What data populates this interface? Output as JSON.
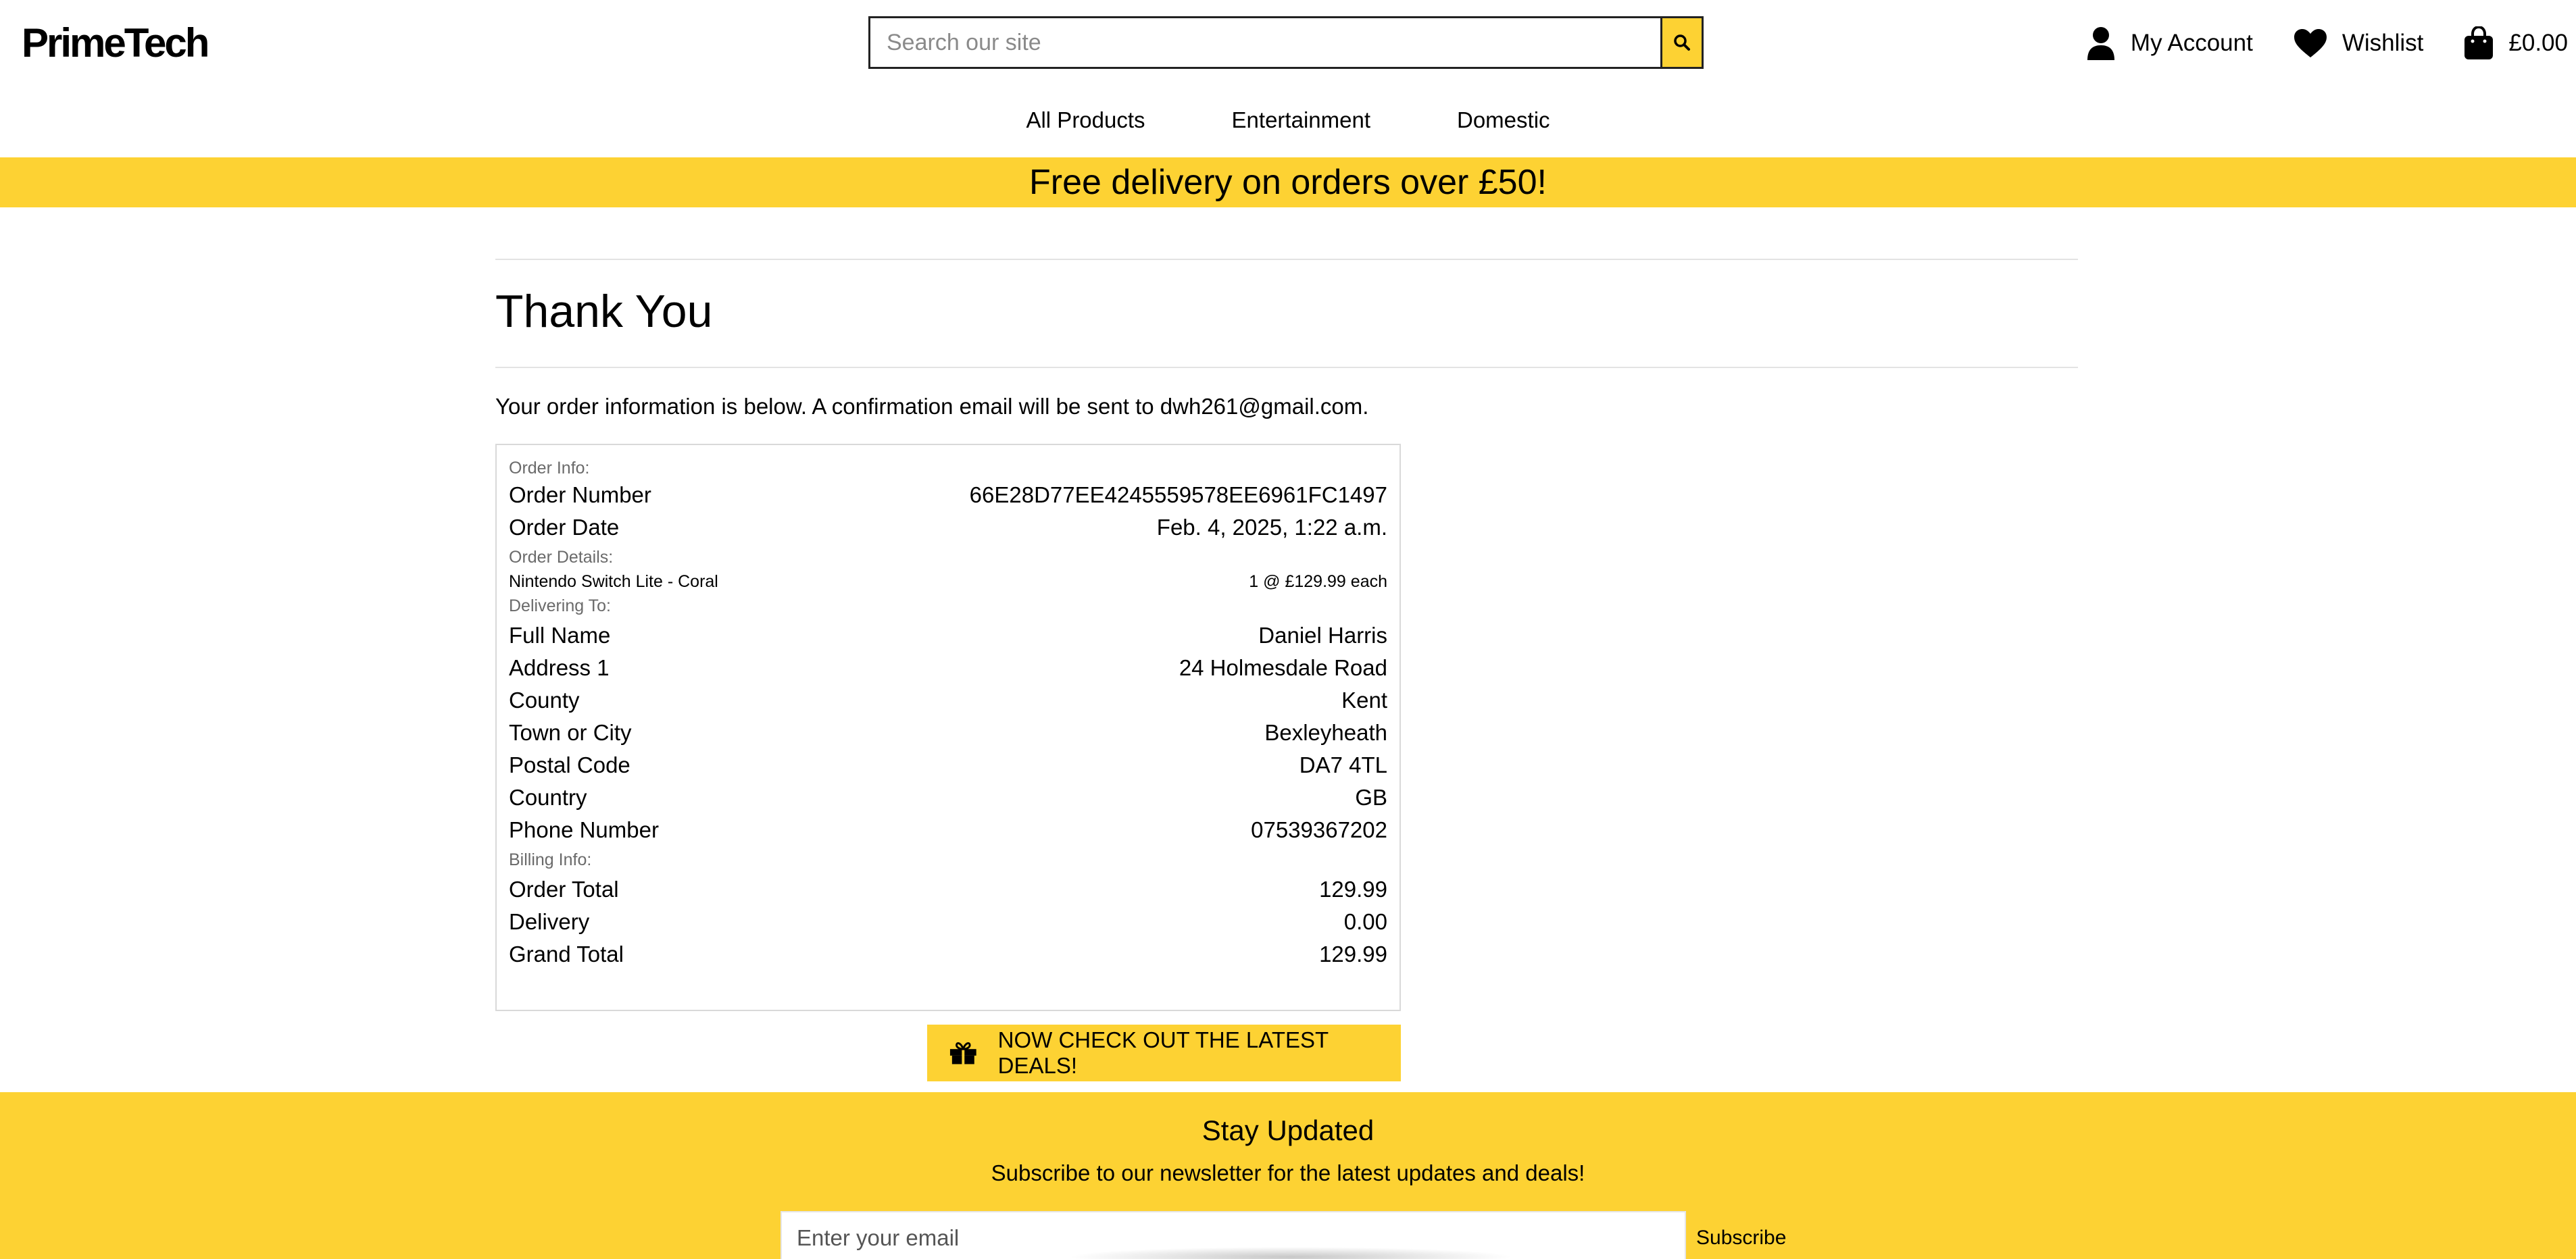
{
  "header": {
    "logo": "PrimeTech",
    "search": {
      "placeholder": "Search our site",
      "value": ""
    },
    "account_label": "My Account",
    "wishlist_label": "Wishlist",
    "bag_total": "£0.00"
  },
  "menu": {
    "items": [
      {
        "label": "All Products"
      },
      {
        "label": "Entertainment"
      },
      {
        "label": "Domestic"
      }
    ]
  },
  "banner": {
    "text": "Free delivery on orders over £50!"
  },
  "page": {
    "title": "Thank You",
    "intro": "Your order information is below. A confirmation email will be sent to dwh261@gmail.com."
  },
  "order": {
    "order_info_label": "Order Info:",
    "order_number_label": "Order Number",
    "order_number": "66E28D77EE4245559578EE6961FC1497",
    "order_date_label": "Order Date",
    "order_date": "Feb. 4, 2025, 1:22 a.m.",
    "order_details_label": "Order Details:",
    "product_name": "Nintendo Switch Lite - Coral",
    "product_qty": "1 @ £129.99 each",
    "delivering_label": "Delivering To:",
    "delivery_rows": [
      {
        "label": "Full Name",
        "value": "Daniel Harris"
      },
      {
        "label": "Address 1",
        "value": "24 Holmesdale Road"
      },
      {
        "label": "County",
        "value": "Kent"
      },
      {
        "label": "Town or City",
        "value": "Bexleyheath"
      },
      {
        "label": "Postal Code",
        "value": "DA7 4TL"
      },
      {
        "label": "Country",
        "value": "GB"
      },
      {
        "label": "Phone Number",
        "value": "07539367202"
      }
    ],
    "billing_label": "Billing Info:",
    "billing_rows": [
      {
        "label": "Order Total",
        "value": "129.99"
      },
      {
        "label": "Delivery",
        "value": "0.00"
      },
      {
        "label": "Grand Total",
        "value": "129.99"
      }
    ]
  },
  "deals_button": {
    "label": "NOW CHECK OUT THE LATEST DEALS!",
    "icon": "gift-icon"
  },
  "footer": {
    "title": "Stay Updated",
    "subtitle": "Subscribe to our newsletter for the latest updates and deals!",
    "email_placeholder": "Enter your email",
    "subscribe_label": "Subscribe"
  },
  "colors": {
    "accent": "#fdd233",
    "text": "#000000",
    "muted": "#6a6a6a"
  }
}
